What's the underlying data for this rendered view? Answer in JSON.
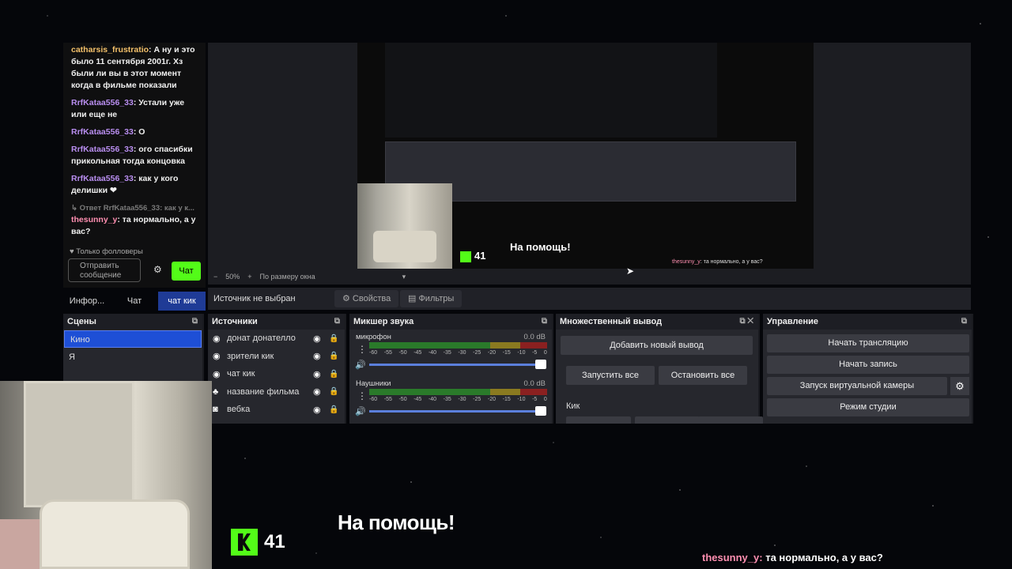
{
  "chat": {
    "messages": [
      {
        "user": "catharsis_frustratio",
        "text": "А ну и это было 11 сентября 2001г. Хз были ли вы в этот момент когда в фильме показали",
        "color": "orange"
      },
      {
        "user": "RrfKataa556_33",
        "text": "Устали уже или еще не",
        "color": "purple"
      },
      {
        "user": "RrfKataa556_33",
        "text": "О",
        "color": "purple"
      },
      {
        "user": "RrfKataa556_33",
        "text": "ого спасибки прикольная тогда концовка",
        "color": "purple"
      },
      {
        "user": "RrfKataa556_33",
        "text": "как у кого делишки ❤",
        "color": "purple"
      }
    ],
    "reply_preview": "↳ Ответ RrfKataa556_33: как у к...",
    "reply_msg": {
      "user": "thesunny_y",
      "text": "та нормально, а у вас?"
    },
    "followers_only": "♥ Только фолловеры",
    "send_placeholder": "Отправить сообщение",
    "chat_button": "Чат"
  },
  "tabs": [
    "Инфор...",
    "Чат",
    "чат кик"
  ],
  "preview": {
    "zoom": "50%",
    "fit": "По размеру окна",
    "help_small": "На помощь!",
    "kick_count_small": "41",
    "sub_user_small": "thesunny_y",
    "sub_text_small": "та нормально, а у вас?"
  },
  "toolbar": {
    "no_source": "Источник не выбран",
    "properties": "⚙ Свойства",
    "filters": "▤ Фильтры"
  },
  "scenes": {
    "title": "Сцены",
    "items": [
      "Кино",
      "Я"
    ]
  },
  "sources": {
    "title": "Источники",
    "items": [
      {
        "icon": "◉",
        "name": "донат донателло"
      },
      {
        "icon": "◉",
        "name": "зрители кик"
      },
      {
        "icon": "◉",
        "name": "чат кик"
      },
      {
        "icon": "♣",
        "name": "название фильма"
      },
      {
        "icon": "◙",
        "name": "вебка"
      }
    ]
  },
  "mixer": {
    "title": "Микшер звука",
    "channels": [
      {
        "name": "микрофон",
        "db": "0.0 dB"
      },
      {
        "name": "Наушники",
        "db": "0.0 dB"
      }
    ],
    "scale": [
      "-60",
      "-55",
      "-50",
      "-45",
      "-40",
      "-35",
      "-30",
      "-25",
      "-20",
      "-15",
      "-10",
      "-5",
      "0"
    ]
  },
  "multi": {
    "title": "Множественный вывод",
    "add": "Добавить новый вывод",
    "start_all": "Запустить все",
    "stop_all": "Остановить все",
    "kick": "Кик"
  },
  "control": {
    "title": "Управление",
    "start_stream": "Начать трансляцию",
    "start_rec": "Начать запись",
    "virtual_cam": "Запуск виртуальной камеры",
    "studio": "Режим студии"
  },
  "overlay": {
    "kick_count": "41",
    "help": "На помощь!",
    "sub_user": "thesunny_y:",
    "sub_text": "та нормально, а у вас?"
  }
}
